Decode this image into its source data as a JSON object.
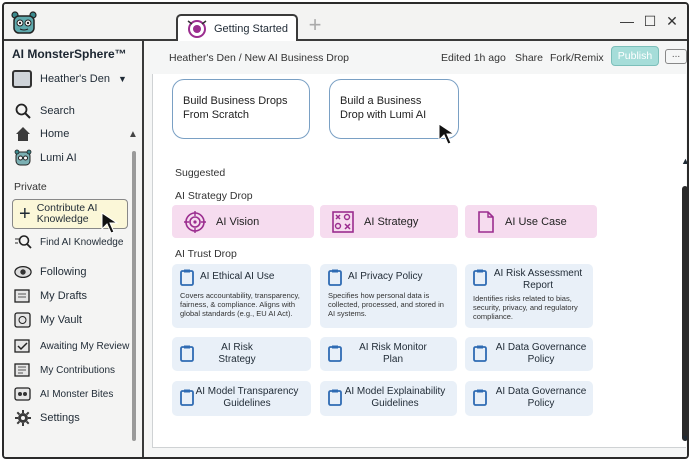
{
  "window": {
    "tab_label": "Getting Started",
    "new_tab_symbol": "+",
    "controls": {
      "minimize": "—",
      "maximize": "☐",
      "close": "✕"
    }
  },
  "sidebar": {
    "brand": "AI MonsterSphere™",
    "workspace": "Heather's Den",
    "search": "Search",
    "home": "Home",
    "lumi": "Lumi AI",
    "private_section": "Private",
    "contribute": "Contribute AI Knowledge",
    "find_knowledge": "Find AI Knowledge",
    "following": "Following",
    "drafts": "My Drafts",
    "vault": "My Vault",
    "awaiting_review": "Awaiting My Review",
    "contributions": "My Contributions",
    "monster_bites": "AI Monster Bites",
    "settings": "Settings"
  },
  "header": {
    "breadcrumb": "Heather's Den / New AI Business Drop",
    "edited": "Edited 1h ago",
    "share": "Share",
    "fork": "Fork/Remix",
    "publish": "Publish",
    "more": "..."
  },
  "start_options": {
    "scratch": "Build Business Drops From Scratch",
    "lumi": "Build a Business Drop with Lumi AI"
  },
  "suggested": {
    "title": "Suggested",
    "strategy_section": "AI Strategy Drop",
    "strategy_items": [
      "AI Vision",
      "AI Strategy",
      "AI Use Case"
    ],
    "trust_section": "AI Trust Drop",
    "trust_cards": [
      {
        "title": "AI Ethical AI Use",
        "desc": "Covers accountability, transparency, fairness, & compliance. Aligns with global standards (e.g., EU AI Act)."
      },
      {
        "title": "AI Privacy Policy",
        "desc": "Specifies how personal data is collected, processed, and stored in AI systems."
      },
      {
        "title": "AI Risk Assessment Report",
        "desc": "Identifies risks related to bias, security, privacy, and regulatory compliance."
      },
      {
        "title": "AI Risk Strategy",
        "desc": ""
      },
      {
        "title": "AI Risk Monitor Plan",
        "desc": ""
      },
      {
        "title": "AI Data Governance Policy",
        "desc": ""
      },
      {
        "title": "AI Model Transparency Guidelines",
        "desc": ""
      },
      {
        "title": "AI Model Explainability Guidelines",
        "desc": ""
      },
      {
        "title": "AI Data Governance Policy",
        "desc": ""
      }
    ]
  },
  "colors": {
    "publish": "#a6ddd9",
    "strategy_card": "#f6dcef",
    "trust_card": "#e9f0f8",
    "start_card_border": "#7aa0c4",
    "contribute_highlight": "#fbf7d8",
    "icon_purple": "#9b2d8f",
    "icon_blue": "#2f6bb3"
  },
  "icons": [
    "monster-logo-icon",
    "lumi-tab-icon",
    "search-icon",
    "home-icon",
    "lumi-monster-icon",
    "plus-icon",
    "search-knowledge-icon",
    "eye-icon",
    "drafts-icon",
    "vault-icon",
    "review-icon",
    "contributions-icon",
    "monster-bites-icon",
    "gear-icon",
    "target-icon",
    "strategy-icon",
    "document-icon",
    "clipboard-icon",
    "cursor-icon"
  ]
}
